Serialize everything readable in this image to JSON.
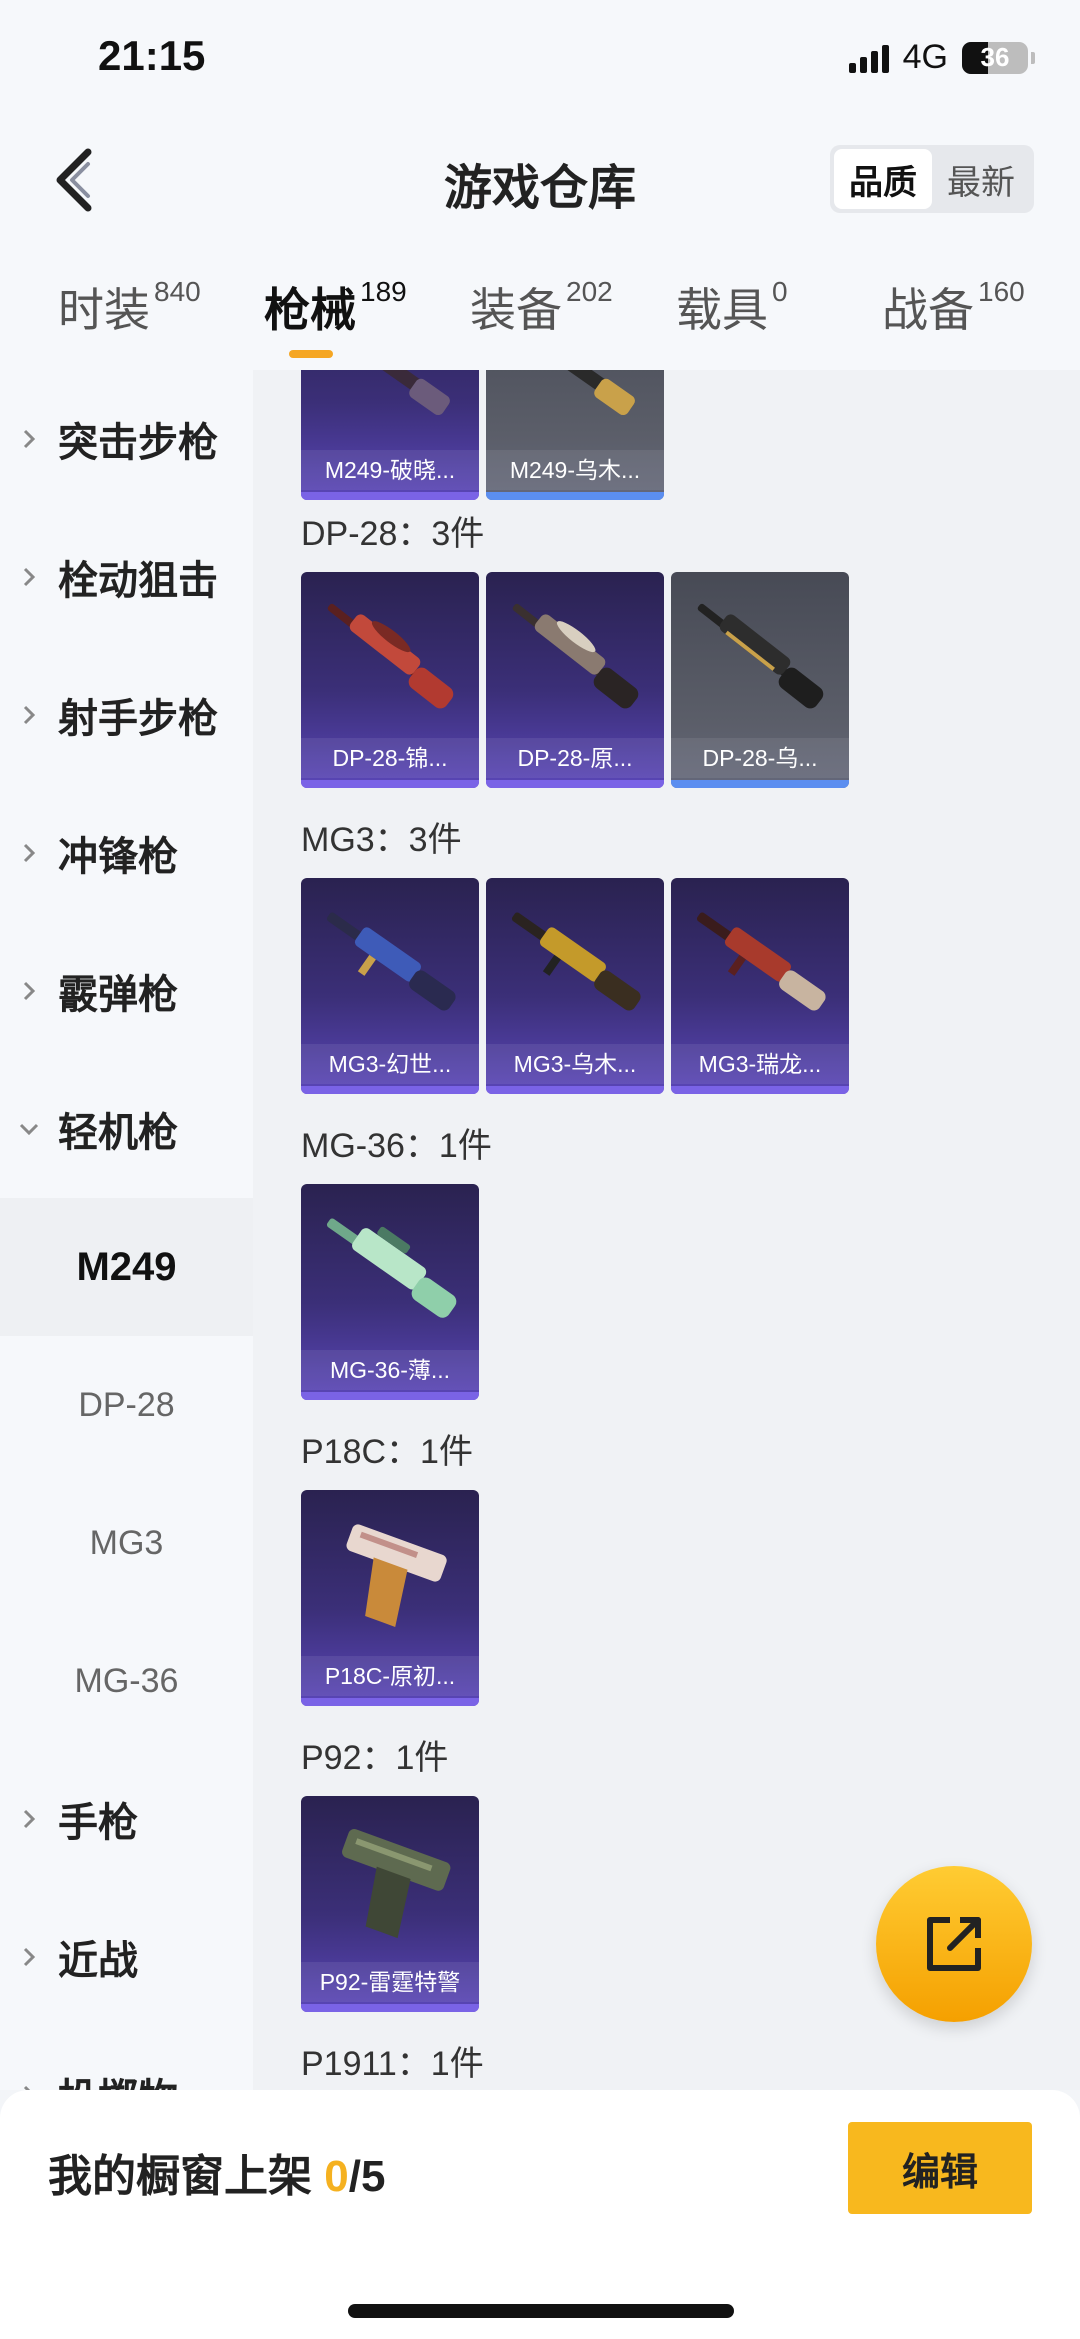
{
  "status_bar": {
    "time": "21:15",
    "network": "4G",
    "battery": "36"
  },
  "header": {
    "title": "游戏仓库",
    "sort_options": [
      "品质",
      "最新"
    ],
    "active_sort": "品质"
  },
  "category_tabs": [
    {
      "label": "时装",
      "count": "840"
    },
    {
      "label": "枪械",
      "count": "189",
      "active": true
    },
    {
      "label": "装备",
      "count": "202"
    },
    {
      "label": "载具",
      "count": "0"
    },
    {
      "label": "战备",
      "count": "160"
    }
  ],
  "sidebar": {
    "categories": [
      "突击步枪",
      "栓动狙击",
      "射手步枪",
      "冲锋枪",
      "霰弹枪",
      "轻机枪",
      "手枪",
      "近战",
      "投掷物"
    ],
    "expanded": "轻机枪",
    "subitems": [
      "M249",
      "DP-28",
      "MG3",
      "MG-36"
    ],
    "active_subitem": "M249"
  },
  "groups": [
    {
      "title": "",
      "items": [
        {
          "label": "M249-破晓...",
          "quality": "purple"
        },
        {
          "label": "M249-乌木...",
          "quality": "blue"
        }
      ]
    },
    {
      "title": "DP-28：3件",
      "items": [
        {
          "label": "DP-28-锦...",
          "quality": "purple"
        },
        {
          "label": "DP-28-原...",
          "quality": "purple"
        },
        {
          "label": "DP-28-乌...",
          "quality": "blue"
        }
      ]
    },
    {
      "title": "MG3：3件",
      "items": [
        {
          "label": "MG3-幻世...",
          "quality": "purple"
        },
        {
          "label": "MG3-乌木...",
          "quality": "purple"
        },
        {
          "label": "MG3-瑞龙...",
          "quality": "purple"
        }
      ]
    },
    {
      "title": "MG-36：1件",
      "items": [
        {
          "label": "MG-36-薄...",
          "quality": "purple"
        }
      ]
    },
    {
      "title": "P18C：1件",
      "items": [
        {
          "label": "P18C-原初...",
          "quality": "purple"
        }
      ]
    },
    {
      "title": "P92：1件",
      "items": [
        {
          "label": "P92-雷霆特警",
          "quality": "purple"
        }
      ]
    },
    {
      "title": "P1911：1件",
      "items": []
    }
  ],
  "bottom_bar": {
    "showcase_label": "我的橱窗上架",
    "showcase_current": "0",
    "showcase_total": "/5",
    "edit_label": "编辑"
  },
  "colors": {
    "accent": "#f5a623",
    "purple_card": "#3b2f78",
    "grey_card": "#5b5e69"
  }
}
